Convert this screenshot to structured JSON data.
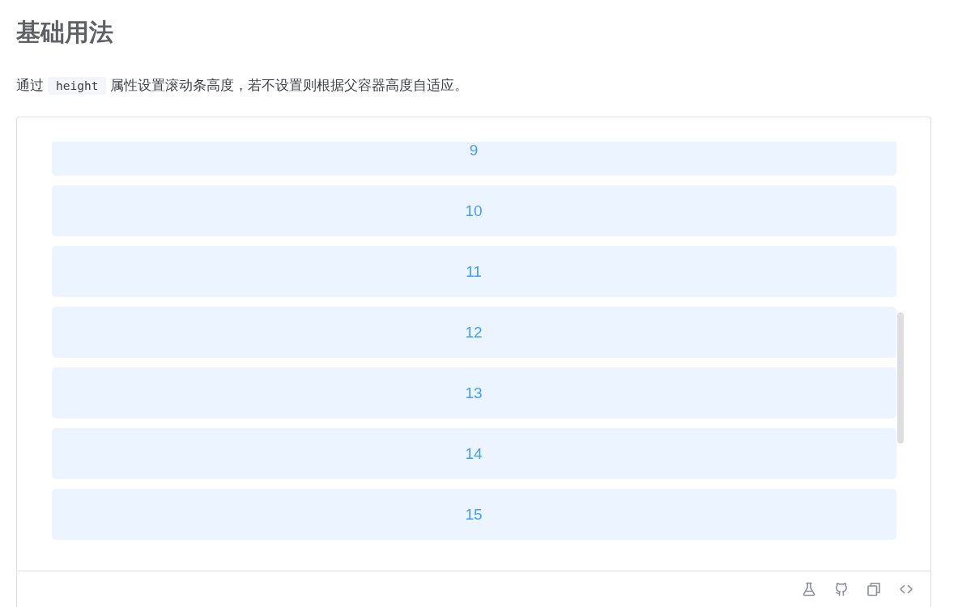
{
  "heading": "基础用法",
  "description": {
    "parts": [
      {
        "kind": "text",
        "text": "通过"
      },
      {
        "kind": "code",
        "text": "height"
      },
      {
        "kind": "text",
        "text": "属性设置滚动条高度，若不设置则根据父容器高度自适应。"
      }
    ]
  },
  "demo": {
    "items": [
      "9",
      "10",
      "11",
      "12",
      "13",
      "14",
      "15"
    ]
  }
}
